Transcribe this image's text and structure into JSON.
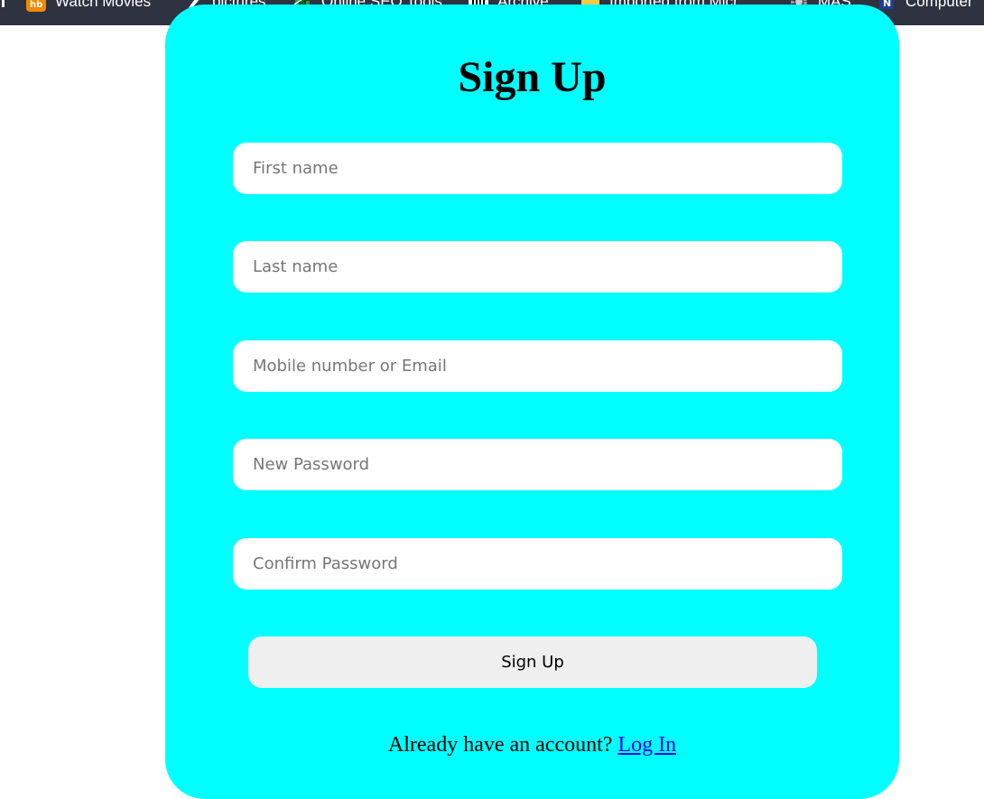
{
  "bookmarks": {
    "items": [
      {
        "label": "Watch Movies",
        "icon": "movie-icon"
      },
      {
        "label": "pictures",
        "icon": "pen-icon"
      },
      {
        "label": "Online SEO Tools",
        "icon": "seo-icon"
      },
      {
        "label": "Archive",
        "icon": "archive-icon"
      },
      {
        "label": "Imported from Micr...",
        "icon": "folder-icon"
      },
      {
        "label": "MAS",
        "icon": "gear-icon"
      },
      {
        "label": "Computer",
        "icon": "computer-icon"
      }
    ]
  },
  "form": {
    "title": "Sign Up",
    "fields": {
      "first_name": {
        "placeholder": "First name",
        "value": ""
      },
      "last_name": {
        "placeholder": "Last name",
        "value": ""
      },
      "contact": {
        "placeholder": "Mobile number or Email",
        "value": ""
      },
      "new_password": {
        "placeholder": "New Password",
        "value": ""
      },
      "confirm_password": {
        "placeholder": "Confirm Password",
        "value": ""
      }
    },
    "submit_label": "Sign Up",
    "footer_text": "Already have an account? ",
    "login_link_label": "Log In"
  },
  "colors": {
    "card_background": "#00ffff",
    "bookmarks_bar": "#2f3241",
    "link": "#0000ee",
    "button_background": "#efefef"
  }
}
